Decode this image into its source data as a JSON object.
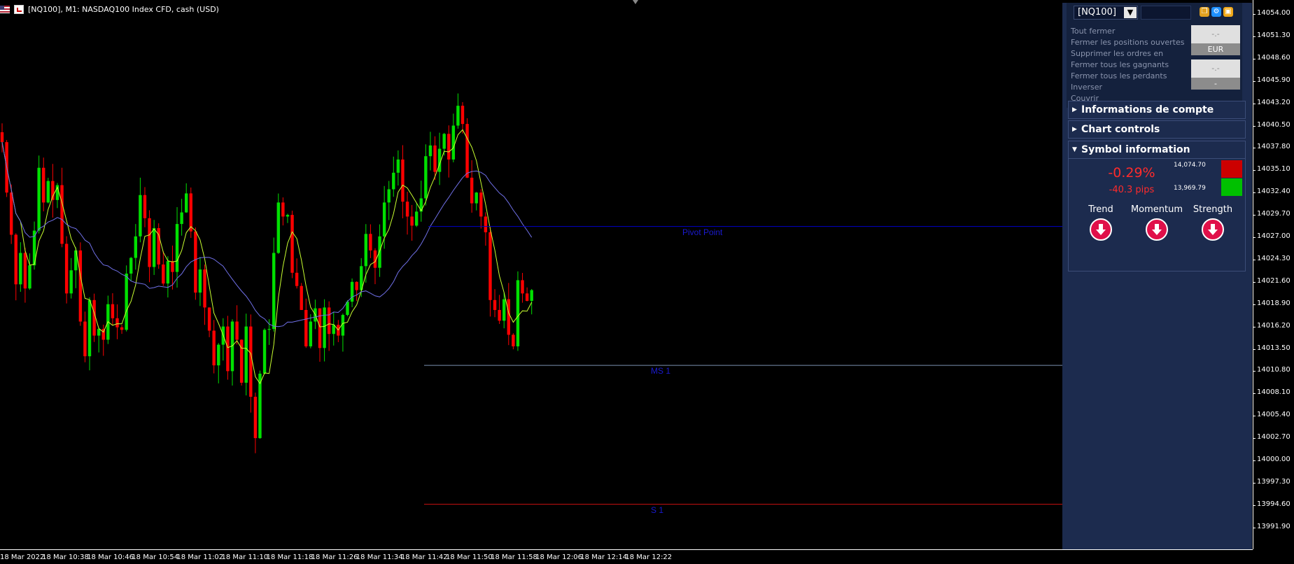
{
  "header": {
    "title": "[NQ100], M1:  NASDAQ100 Index CFD, cash (USD)"
  },
  "y_axis": {
    "labels": [
      "14054.00",
      "14051.30",
      "14048.60",
      "14045.90",
      "14043.20",
      "14040.50",
      "14037.80",
      "14035.10",
      "14032.40",
      "14029.70",
      "14027.00",
      "14024.30",
      "14021.60",
      "14018.90",
      "14016.20",
      "14013.50",
      "14010.80",
      "14008.10",
      "14005.40",
      "14002.70",
      "14000.00",
      "13997.30",
      "13994.60",
      "13991.90"
    ]
  },
  "x_axis": {
    "labels": [
      "18 Mar 2022",
      "18 Mar 10:38",
      "18 Mar 10:46",
      "18 Mar 10:54",
      "18 Mar 11:02",
      "18 Mar 11:10",
      "18 Mar 11:18",
      "18 Mar 11:26",
      "18 Mar 11:34",
      "18 Mar 11:42",
      "18 Mar 11:50",
      "18 Mar 11:58",
      "18 Mar 12:06",
      "18 Mar 12:14",
      "18 Mar 12:22"
    ]
  },
  "levels": [
    {
      "label": "Pivot Point",
      "price": 14028.3,
      "color": "#0000cc",
      "label_color": "#1a1ad0"
    },
    {
      "label": "MS 1",
      "price": 14011.5,
      "color": "#7a8fb0",
      "label_color": "#1a1ad0"
    },
    {
      "label": "S 1",
      "price": 13994.7,
      "color": "#cc1010",
      "label_color": "#1a1ad0"
    }
  ],
  "colors": {
    "bull": "#00e000",
    "bear": "#ff0000",
    "fast_ma": "#c8ff30",
    "slow_ma": "#7070e8",
    "axis": "#ffffff",
    "panel_bg": "#1c2b4e"
  },
  "chart_data": {
    "type": "candlestick",
    "title": "[NQ100], M1:  NASDAQ100 Index CFD, cash (USD)",
    "y_range": [
      13991.9,
      14054.0
    ],
    "x_range": [
      "18 Mar 10:29",
      "18 Mar 12:24"
    ],
    "closes": [
      14038.5,
      14032.4,
      14027.3,
      14021.3,
      14025.1,
      14020.8,
      14023.6,
      14027.8,
      14035.4,
      14031.2,
      14033.8,
      14031.5,
      14033.3,
      14026.2,
      14020.2,
      14023.0,
      14025.4,
      14016.8,
      14012.6,
      14019.4,
      14015.1,
      14015.9,
      14014.6,
      14018.9,
      14017.2,
      14016.1,
      14015.8,
      14022.6,
      14024.5,
      14027.1,
      14032.1,
      14029.3,
      14023.4,
      14028.1,
      14023.7,
      14021.4,
      14024.1,
      14022.8,
      14028.6,
      14030.0,
      14032.3,
      14027.7,
      14020.3,
      14023.1,
      14018.5,
      14015.7,
      14011.5,
      14014.0,
      14016.2,
      14010.8,
      14016.8,
      14014.6,
      14009.4,
      14016.2,
      14007.7,
      14002.7,
      14010.5,
      14015.8,
      14015.9,
      14025.1,
      14031.2,
      14029.5,
      14029.7,
      14022.7,
      14021.1,
      14018.2,
      14013.8,
      14016.8,
      14018.4,
      14013.6,
      14018.5,
      14015.3,
      14016.4,
      14015.1,
      14017.6,
      14019.2,
      14021.6,
      14020.6,
      14023.5,
      14027.4,
      14025.4,
      14023.3,
      14027.1,
      14031.2,
      14032.8,
      14034.8,
      14036.4,
      14031.3,
      14029.5,
      14028.4,
      14030.1,
      14031.7,
      14036.8,
      14038.1,
      14034.9,
      14037.7,
      14039.5,
      14036.4,
      14040.5,
      14042.9,
      14040.7,
      14034.2,
      14031.1,
      14032.4,
      14029.5,
      14027.6,
      14019.4,
      14018.2,
      14016.9,
      14019.5,
      14015.2,
      14013.8,
      14021.8,
      14020.2,
      14019.3,
      14020.6
    ]
  },
  "panel": {
    "symbol": "[NQ100]",
    "actions": [
      "Tout fermer",
      "Fermer les positions ouvertes",
      "Supprimer les ordres en",
      "Fermer tous les gagnants",
      "Fermer tous les perdants",
      "Inverser",
      "Couvrir"
    ],
    "buttons": [
      {
        "value": "-.-",
        "sub": "EUR"
      },
      {
        "value": "-.-",
        "sub": "-"
      }
    ],
    "sections": [
      "Informations de compte",
      "Chart controls",
      "Symbol information"
    ],
    "symbol_info": {
      "change_pct": "-0.29%",
      "change_pips": "-40.3 pips",
      "high": "14,074.70",
      "low": "13,969.79",
      "high_color": "#cc0000",
      "low_color": "#00c000"
    },
    "indicators": [
      {
        "label": "Trend",
        "direction": "down"
      },
      {
        "label": "Momentum",
        "direction": "down"
      },
      {
        "label": "Strength",
        "direction": "down"
      }
    ]
  }
}
